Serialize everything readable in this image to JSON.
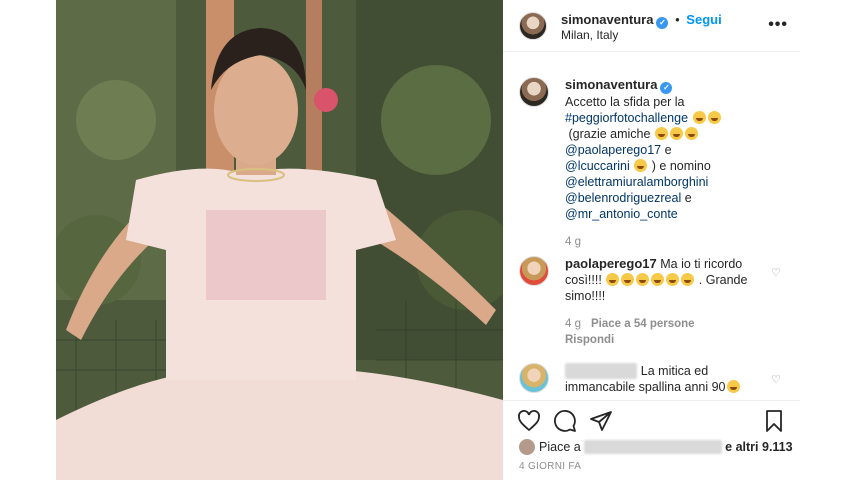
{
  "colors": {
    "accent": "#0095f6",
    "tag": "#00376b",
    "muted": "#8e8e8e",
    "text": "#262626",
    "verified": "#3897f0"
  },
  "header": {
    "username": "simonaventura",
    "separator": "•",
    "follow_label": "Segui",
    "location": "Milan, Italy",
    "more_icon": "ellipsis-icon",
    "more_glyph": "•••"
  },
  "caption": {
    "username": "simonaventura",
    "text_1": "Accetto la sfida per la",
    "hashtag": "#peggiorfotochallenge",
    "text_2": "(grazie amiche",
    "mention_1": "@paolaperego17",
    "text_3": "e",
    "mention_2": "@lcuccarini",
    "text_4": ") e nomino",
    "mention_3": "@elettramiuralamborghini",
    "mention_4": "@belenrodriguezreal",
    "text_5": "e",
    "mention_5": "@mr_antonio_conte",
    "time": "4 g"
  },
  "comments": [
    {
      "username": "paolaperego17",
      "text_1": "Ma io ti ricordo così!!!!",
      "text_2": ". Grande simo!!!!",
      "time": "4 g",
      "likes": "Piace a 54 persone",
      "reply": "Rispondi"
    },
    {
      "username_hidden": "xxxxxxxxxx",
      "text": "La mitica ed immancabile spallina anni 90"
    }
  ],
  "actions": {
    "like_icon": "heart-icon",
    "comment_icon": "comment-icon",
    "share_icon": "send-icon",
    "save_icon": "bookmark-icon"
  },
  "likes": {
    "prefix": "Piace a",
    "hidden": "xxxxxxxxxxxxxxxxxxxxxx",
    "suffix": "e altri 9.113"
  },
  "date": "4 GIORNI FA"
}
